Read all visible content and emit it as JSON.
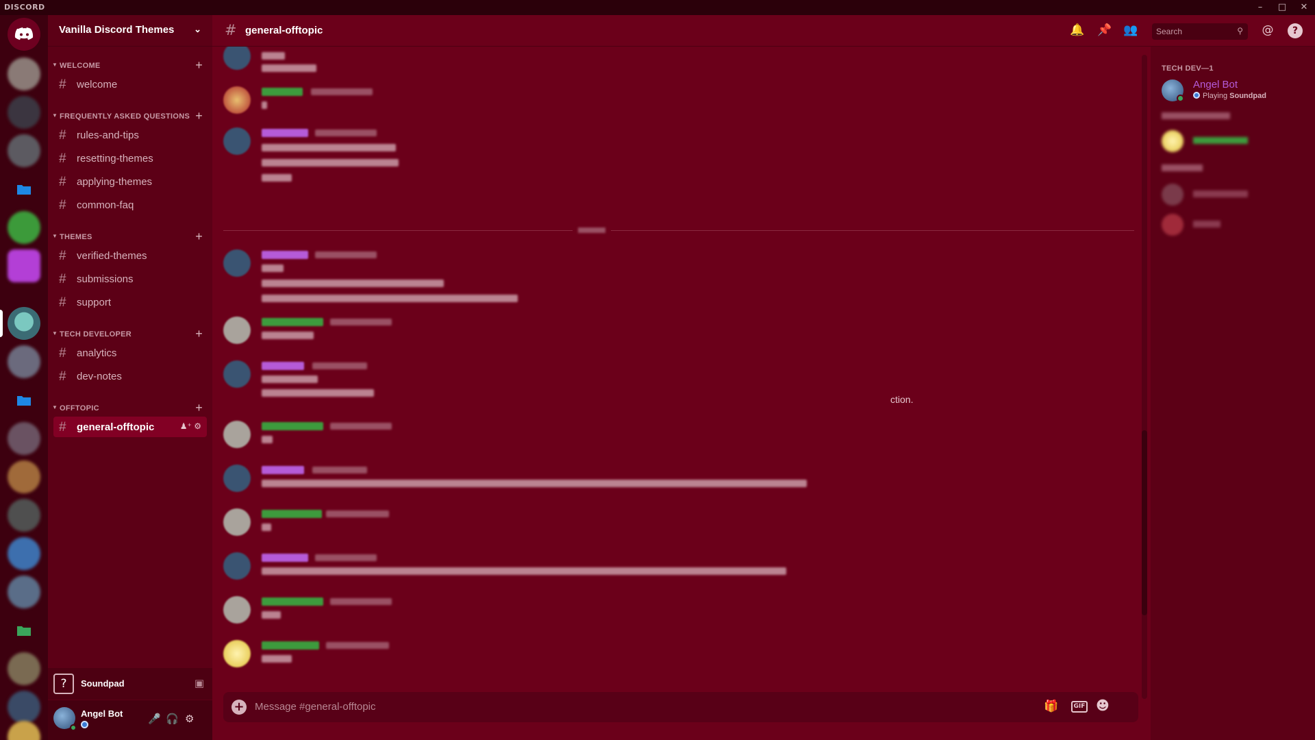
{
  "window": {
    "brand": "DISCORD",
    "controls": [
      "–",
      "□",
      "✕"
    ]
  },
  "server": {
    "name": "Vanilla Discord Themes"
  },
  "categories": [
    {
      "name": "WELCOME",
      "channels": [
        "welcome"
      ]
    },
    {
      "name": "FREQUENTLY ASKED QUESTIONS",
      "channels": [
        "rules-and-tips",
        "resetting-themes",
        "applying-themes",
        "common-faq"
      ]
    },
    {
      "name": "THEMES",
      "channels": [
        "verified-themes",
        "submissions",
        "support"
      ]
    },
    {
      "name": "TECH DEVELOPER",
      "channels": [
        "analytics",
        "dev-notes"
      ]
    },
    {
      "name": "OFFTOPIC",
      "channels": [
        "general-offtopic"
      ]
    }
  ],
  "active_channel": "general-offtopic",
  "activity": {
    "label": "Soundpad"
  },
  "user": {
    "name": "Angel Bot"
  },
  "chat": {
    "title": "general-offtopic",
    "search_placeholder": "Search",
    "visible_fragment": "ction.",
    "composer_placeholder": "Message #general-offtopic"
  },
  "members": {
    "group": "TECH DEV—1",
    "list": [
      {
        "name": "Angel Bot",
        "activity": "Playing",
        "activity_app": "Soundpad"
      }
    ]
  },
  "icons": {
    "bell": "bell-icon",
    "pin": "pin-icon",
    "members": "members-icon",
    "mention": "mention-icon",
    "help": "help-icon",
    "gift": "gift-icon",
    "gif": "gif-icon",
    "emoji": "emoji-icon"
  },
  "colors": {
    "accent": "#6b001a",
    "sidebar": "#5c0016",
    "active_channel_bg": "#820024",
    "online": "#3ba55c",
    "member_name": "#b55bd8"
  }
}
